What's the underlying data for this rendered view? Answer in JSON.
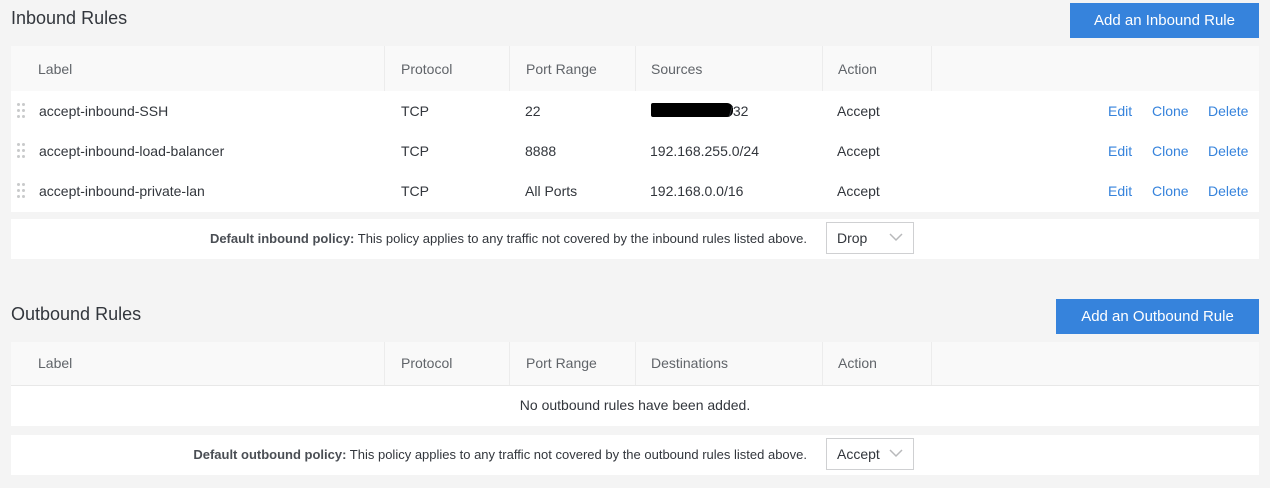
{
  "inbound": {
    "title": "Inbound Rules",
    "add_button": "Add an Inbound Rule",
    "columns": [
      "Label",
      "Protocol",
      "Port Range",
      "Sources",
      "Action"
    ],
    "rules": [
      {
        "label": "accept-inbound-SSH",
        "protocol": "TCP",
        "ports": "22",
        "address": "/32",
        "action": "Accept",
        "edit": "Edit",
        "clone": "Clone",
        "delete": "Delete"
      },
      {
        "label": "accept-inbound-load-balancer",
        "protocol": "TCP",
        "ports": "8888",
        "address": "192.168.255.0/24",
        "action": "Accept",
        "edit": "Edit",
        "clone": "Clone",
        "delete": "Delete"
      },
      {
        "label": "accept-inbound-private-lan",
        "protocol": "TCP",
        "ports": "All Ports",
        "address": "192.168.0.0/16",
        "action": "Accept",
        "edit": "Edit",
        "clone": "Clone",
        "delete": "Delete"
      }
    ],
    "policy_label": "Default inbound policy:",
    "policy_desc": " This policy applies to any traffic not covered by the inbound rules listed above.",
    "policy_value": "Drop"
  },
  "outbound": {
    "title": "Outbound Rules",
    "add_button": "Add an Outbound Rule",
    "columns": [
      "Label",
      "Protocol",
      "Port Range",
      "Destinations",
      "Action"
    ],
    "empty_message": "No outbound rules have been added.",
    "policy_label": "Default outbound policy:",
    "policy_desc": " This policy applies to any traffic not covered by the outbound rules listed above.",
    "policy_value": "Accept"
  },
  "colors": {
    "accent": "#3683dc",
    "background": "#f4f4f4",
    "header_bg": "#f9f9f9"
  },
  "icons": {
    "drag": "drag-handle-icon",
    "select": "chevron-down-icon"
  }
}
